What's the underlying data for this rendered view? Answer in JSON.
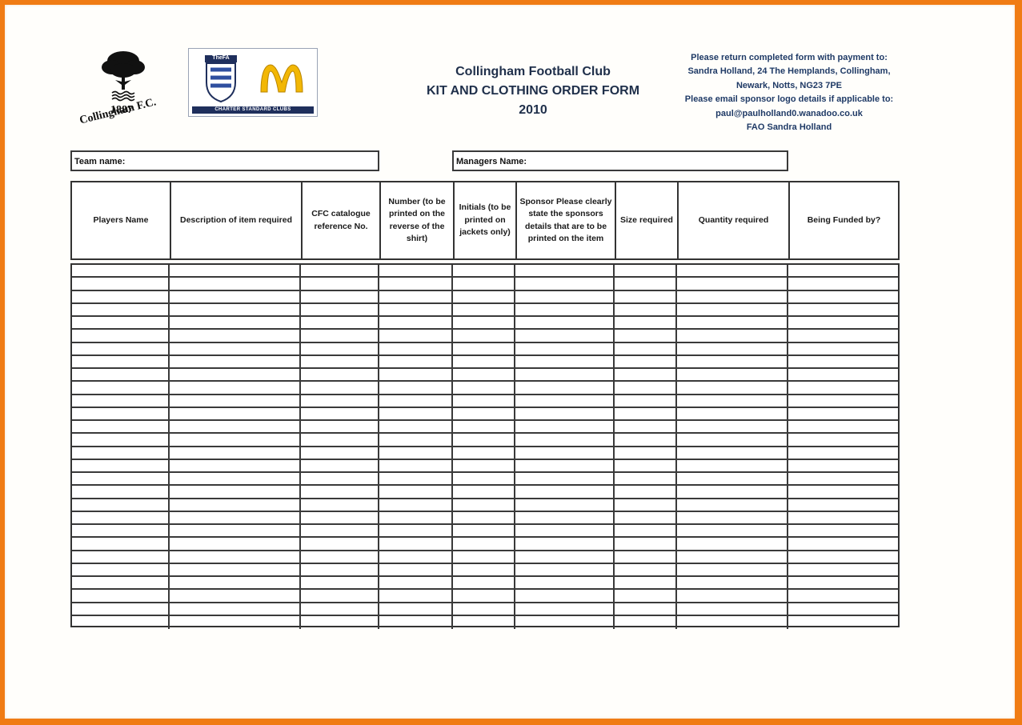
{
  "logos": {
    "club": {
      "year": "1887",
      "name": "Collingham F.C."
    },
    "partner": {
      "fa_label": "TheFA",
      "strip_text": "CHARTER STANDARD CLUBS",
      "sponsor_mark": "M"
    }
  },
  "header": {
    "club_name": "Collingham Football Club",
    "form_title": "KIT AND CLOTHING ORDER FORM",
    "year": "2010"
  },
  "contact": {
    "lines": [
      "Please return completed form with payment to:",
      "Sandra Holland, 24 The Hemplands, Collingham,",
      "Newark, Notts, NG23 7PE",
      "Please email sponsor logo details if applicable to:",
      "paul@paulholland0.wanadoo.co.uk",
      "FAO Sandra Holland"
    ]
  },
  "fields": {
    "team_name_label": "Team name:",
    "team_name_value": "",
    "managers_name_label": "Managers Name:",
    "managers_name_value": ""
  },
  "table": {
    "columns": [
      {
        "key": "players_name",
        "label": "Players Name"
      },
      {
        "key": "description",
        "label": "Description of item required"
      },
      {
        "key": "catalogue_ref",
        "label": "CFC catalogue reference No."
      },
      {
        "key": "number",
        "label": "Number (to be printed on the reverse of the shirt)"
      },
      {
        "key": "initials",
        "label": "Initials (to be printed on jackets only)"
      },
      {
        "key": "sponsor",
        "label": "Sponsor Please clearly state the sponsors details that are to be printed on the item"
      },
      {
        "key": "size",
        "label": "Size required"
      },
      {
        "key": "quantity",
        "label": "Quantity required"
      },
      {
        "key": "funded_by",
        "label": "Being Funded by?"
      }
    ],
    "empty_row_count": 28
  },
  "colors": {
    "page_border": "#f07c14",
    "title_text": "#1f2f4a",
    "contact_text": "#1f3a66",
    "grid_lines": "#333333"
  }
}
